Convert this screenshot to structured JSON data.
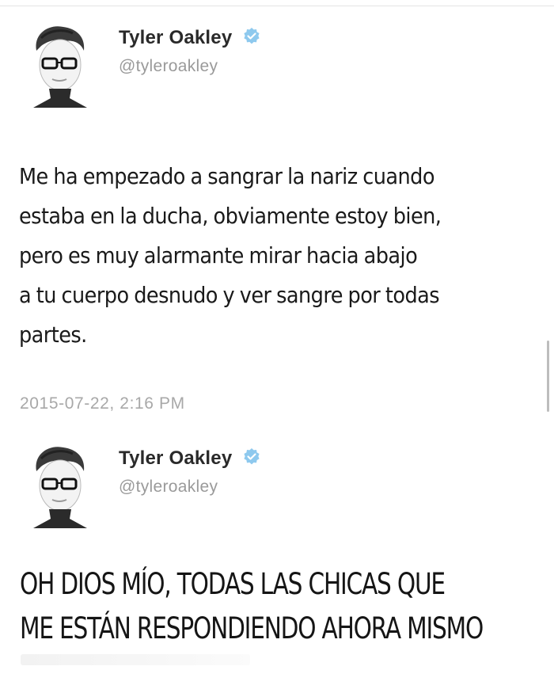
{
  "tweets": [
    {
      "author": {
        "name": "Tyler Oakley",
        "handle": "@tyleroakley",
        "verified_icon": "verified-badge-icon"
      },
      "text_lines": [
        "Me ha empezado a sangrar la nariz cuando",
        "estaba en la ducha, obviamente estoy bien,",
        "pero es muy alarmante mirar hacia abajo",
        "a tu cuerpo desnudo y ver sangre por todas",
        "partes."
      ],
      "timestamp": "2015-07-22, 2:16 PM"
    },
    {
      "author": {
        "name": "Tyler Oakley",
        "handle": "@tyleroakley",
        "verified_icon": "verified-badge-icon"
      },
      "text_lines": [
        "OH DIOS MÍO, TODAS LAS CHICAS QUE",
        "ME ESTÁN RESPONDIENDO AHORA MISMO"
      ]
    }
  ],
  "colors": {
    "name": "#2a2a2a",
    "handle": "#9a9a9a",
    "verified": "#8ec9ee",
    "timestamp": "#a8a8a8"
  }
}
